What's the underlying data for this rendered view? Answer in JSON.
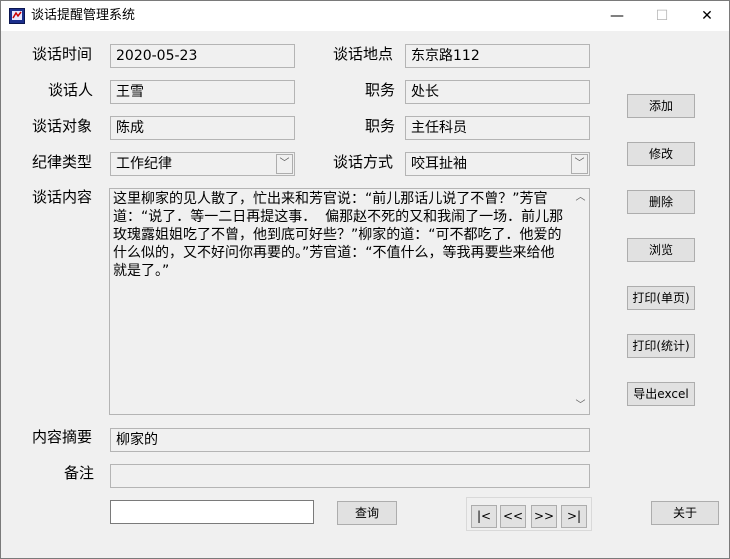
{
  "window": {
    "title": "谈话提醒管理系统",
    "minimize": "—",
    "maximize": "☐",
    "close": "✕"
  },
  "labels": {
    "talk_time": "谈话时间",
    "talk_place": "谈话地点",
    "talker": "谈话人",
    "position1": "职务",
    "target": "谈话对象",
    "position2": "职务",
    "discipline_type": "纪律类型",
    "talk_method": "谈话方式",
    "content": "谈话内容",
    "summary": "内容摘要",
    "remark": "备注"
  },
  "fields": {
    "talk_time": "2020-05-23",
    "talk_place": "东京路112",
    "talker": "王雪",
    "position1": "处长",
    "target": "陈成",
    "position2": "主任科员",
    "discipline_type": "工作纪律",
    "talk_method": "咬耳扯袖",
    "content": "这里柳家的见人散了，忙出来和芳官说：“前儿那话儿说了不曾？”芳官道：“说了．等一二日再提这事．  偏那赵不死的又和我闹了一场．前儿那玫瑰露姐姐吃了不曾，他到底可好些？”柳家的道：“可不都吃了．他爱的什么似的，又不好问你再要的。”芳官道：“不值什么，等我再要些来给他就是了。”",
    "summary": "柳家的",
    "remark": "",
    "search": ""
  },
  "buttons": {
    "add": "添加",
    "edit": "修改",
    "delete": "删除",
    "browse": "浏览",
    "print_single": "打印(单页)",
    "print_stats": "打印(统计)",
    "export_excel": "导出excel",
    "query": "查询",
    "about": "关于",
    "first": "|<",
    "prev": "<<",
    "next": ">>",
    "last": ">|"
  },
  "icons": {
    "combo_arrow": "﹀",
    "scroll_up": "︿",
    "scroll_down": "﹀"
  }
}
